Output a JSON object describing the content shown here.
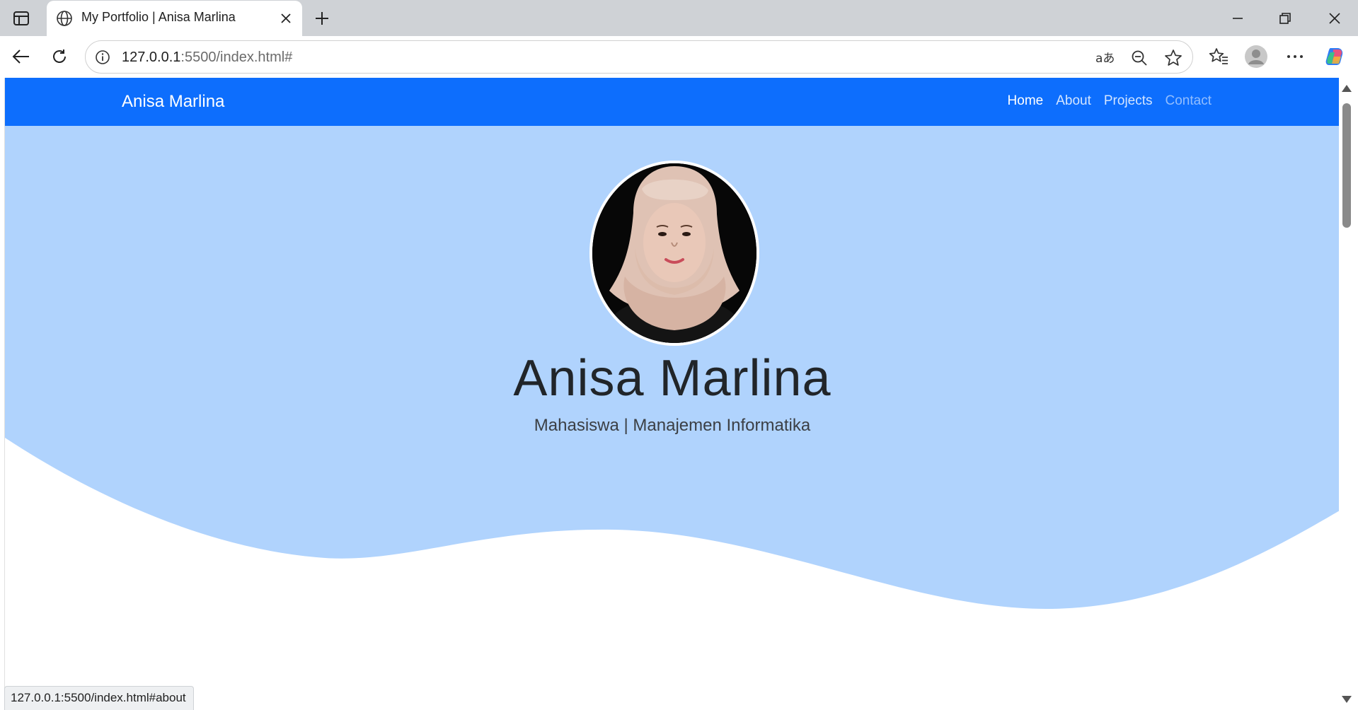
{
  "browser": {
    "tab_title": "My Portfolio | Anisa Marlina",
    "url_host": "127.0.0.1",
    "url_path": ":5500/index.html#",
    "status_url": "127.0.0.1:5500/index.html#about",
    "icons": [
      "sidebar-icon",
      "globe-icon",
      "close-icon",
      "plus-icon",
      "minimize-icon",
      "restore-icon",
      "close-window-icon",
      "back-icon",
      "reload-icon",
      "info-icon",
      "read-aloud-icon",
      "zoom-out-icon",
      "star-icon",
      "favorites-icon",
      "profile-icon",
      "more-icon",
      "copilot-icon"
    ]
  },
  "navbar": {
    "brand": "Anisa Marlina",
    "links": [
      {
        "label": "Home"
      },
      {
        "label": "About"
      },
      {
        "label": "Projects"
      },
      {
        "label": "Contact"
      }
    ],
    "color": "#0d6efd"
  },
  "hero": {
    "name": "Anisa Marlina",
    "subtitle": "Mahasiswa | Manajemen Informatika",
    "background": "#b0d3fd"
  }
}
